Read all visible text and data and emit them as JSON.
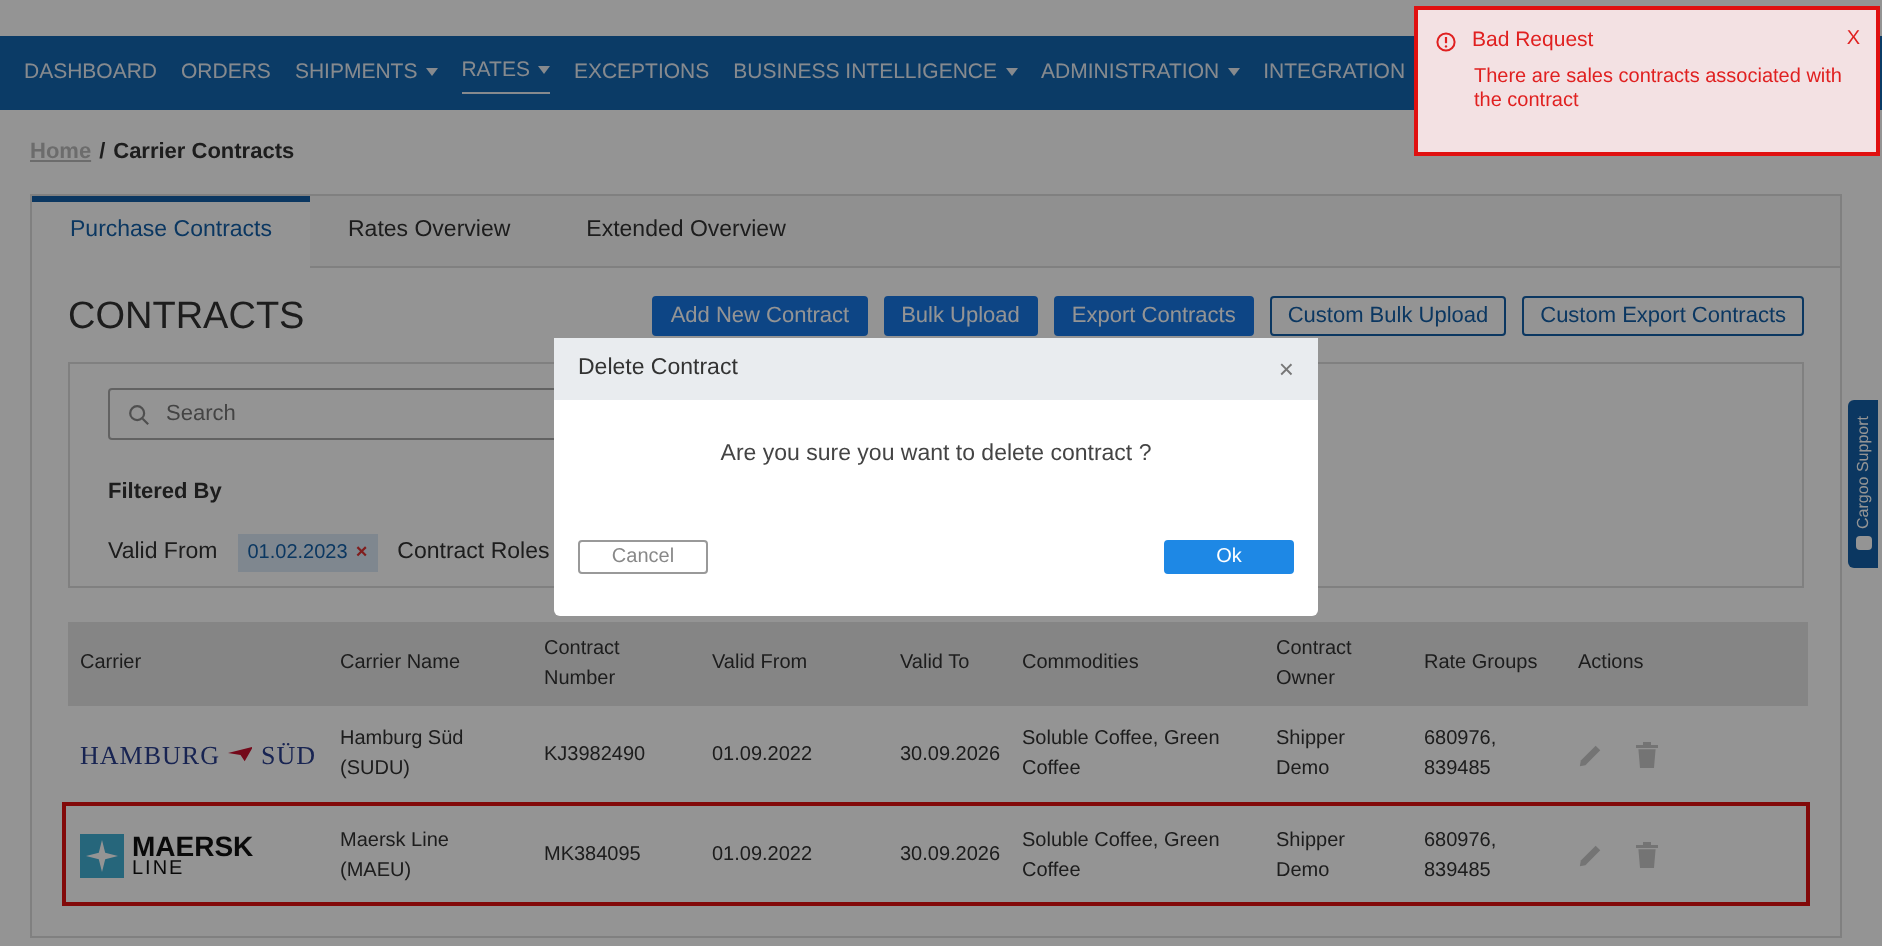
{
  "nav": {
    "items": [
      {
        "label": "DASHBOARD",
        "dropdown": false,
        "selected": false
      },
      {
        "label": "ORDERS",
        "dropdown": false,
        "selected": false
      },
      {
        "label": "SHIPMENTS",
        "dropdown": true,
        "selected": false
      },
      {
        "label": "RATES",
        "dropdown": true,
        "selected": true
      },
      {
        "label": "EXCEPTIONS",
        "dropdown": false,
        "selected": false
      },
      {
        "label": "BUSINESS INTELLIGENCE",
        "dropdown": true,
        "selected": false
      },
      {
        "label": "ADMINISTRATION",
        "dropdown": true,
        "selected": false
      },
      {
        "label": "INTEGRATION",
        "dropdown": false,
        "selected": false
      }
    ]
  },
  "breadcrumb": {
    "items": [
      {
        "label": "Home",
        "kind": "link"
      },
      {
        "label": "Carrier Contracts",
        "kind": "current"
      }
    ],
    "separator": "/"
  },
  "tabs": [
    {
      "label": "Purchase Contracts",
      "selected": true
    },
    {
      "label": "Rates Overview",
      "selected": false
    },
    {
      "label": "Extended Overview",
      "selected": false
    }
  ],
  "page_title": "CONTRACTS",
  "actions": [
    {
      "label": "Add New Contract",
      "kind": "solid"
    },
    {
      "label": "Bulk Upload",
      "kind": "solid"
    },
    {
      "label": "Export Contracts",
      "kind": "solid"
    },
    {
      "label": "Custom Bulk Upload",
      "kind": "outline"
    },
    {
      "label": "Custom Export Contracts",
      "kind": "outline"
    }
  ],
  "search": {
    "placeholder": "Search"
  },
  "filters": {
    "heading": "Filtered By",
    "items": [
      {
        "label": "Valid From",
        "chips": [
          {
            "label": "01.02.2023",
            "remove": "×"
          }
        ]
      },
      {
        "label": "Contract Roles"
      }
    ]
  },
  "table": {
    "columns": [
      "Carrier",
      "Carrier Name",
      "Contract Number",
      "Valid From",
      "Valid To",
      "Commodities",
      "Contract Owner",
      "Rate Groups",
      "Actions"
    ],
    "rows": [
      {
        "cells": [
          {
            "kind": "hamburg",
            "texts": [
              "HAMBURG",
              "SÜD"
            ]
          },
          "Hamburg Süd (SUDU)",
          "KJ3982490",
          "01.09.2022",
          "30.09.2026",
          "Soluble Coffee, Green Coffee",
          "Shipper Demo",
          "680976, 839485"
        ],
        "highlighted": false
      },
      {
        "cells": [
          {
            "kind": "maersk",
            "texts": [
              "MAERSK",
              "LINE"
            ]
          },
          "Maersk Line (MAEU)",
          "MK384095",
          "01.09.2022",
          "30.09.2026",
          "Soluble Coffee, Green Coffee",
          "Shipper Demo",
          "680976, 839485"
        ],
        "highlighted": true
      }
    ]
  },
  "support_tab": {
    "label": "Cargoo Support"
  },
  "modal": {
    "title": "Delete Contract",
    "close": "×",
    "message": "Are you sure you want to delete contract ?",
    "buttons": [
      {
        "label": "Cancel",
        "kind": "secondary"
      },
      {
        "label": "Ok",
        "kind": "primary"
      }
    ]
  },
  "toast": {
    "title": "Bad Request",
    "message": "There are sales contracts associated with the contract",
    "close": "X",
    "highlighted": true
  }
}
